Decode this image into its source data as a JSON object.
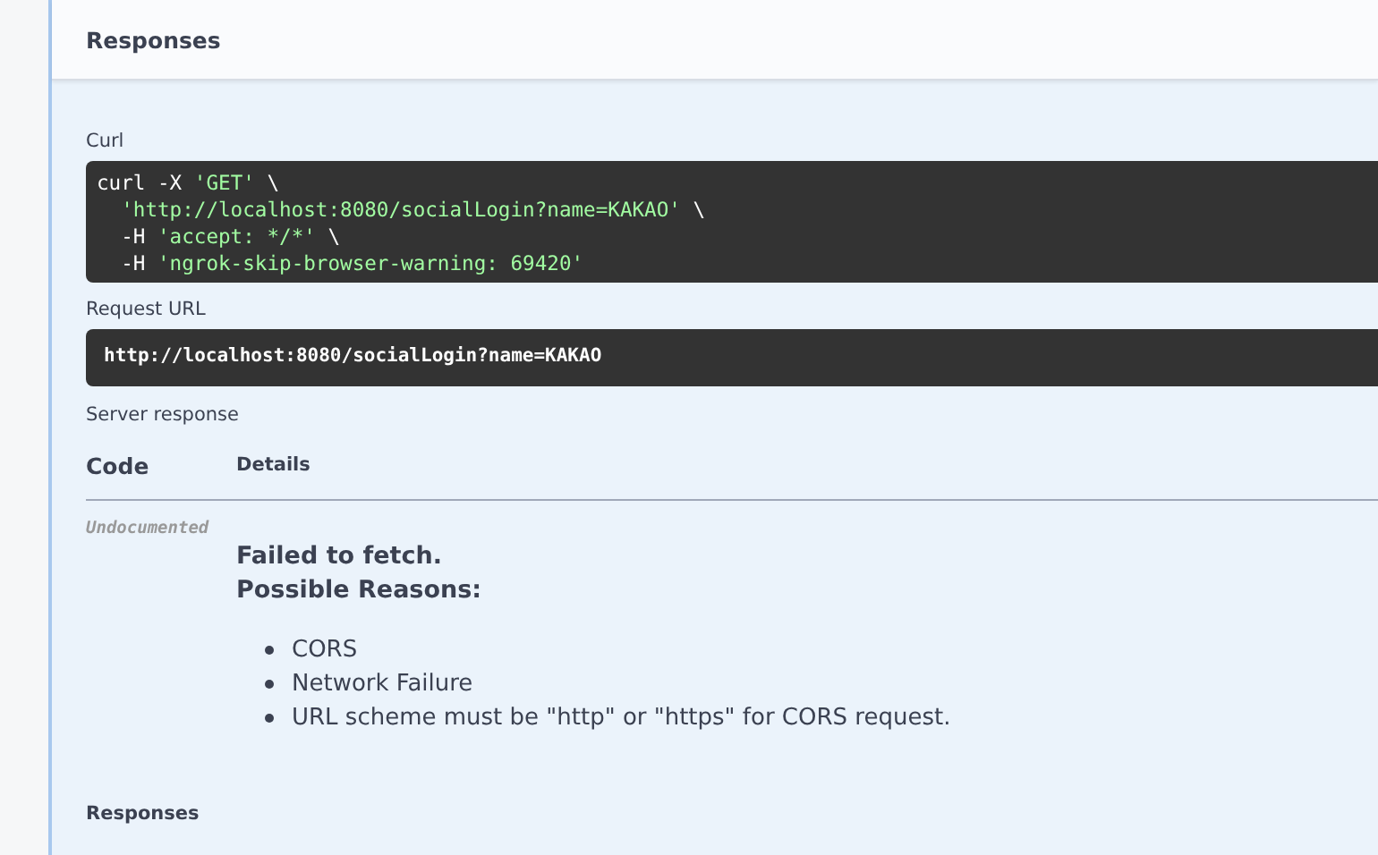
{
  "header": {
    "title": "Responses"
  },
  "curl": {
    "label": "Curl",
    "lines": [
      {
        "indented": false,
        "segments": [
          {
            "kind": "plain",
            "text": "curl -X "
          },
          {
            "kind": "string",
            "text": "'GET'"
          },
          {
            "kind": "plain",
            "text": " \\"
          }
        ]
      },
      {
        "indented": true,
        "segments": [
          {
            "kind": "string",
            "text": "'http://localhost:8080/socialLogin?name=KAKAO'"
          },
          {
            "kind": "plain",
            "text": " \\"
          }
        ]
      },
      {
        "indented": true,
        "segments": [
          {
            "kind": "plain",
            "text": "-H "
          },
          {
            "kind": "string",
            "text": "'accept: */*'"
          },
          {
            "kind": "plain",
            "text": " \\"
          }
        ]
      },
      {
        "indented": true,
        "segments": [
          {
            "kind": "plain",
            "text": "-H "
          },
          {
            "kind": "string",
            "text": "'ngrok-skip-browser-warning: 69420'"
          }
        ]
      }
    ]
  },
  "request_url": {
    "label": "Request URL",
    "value": "http://localhost:8080/socialLogin?name=KAKAO"
  },
  "server_response": {
    "label": "Server response",
    "columns": [
      "Code",
      "Details"
    ],
    "rows": [
      {
        "code": "Undocumented",
        "message": [
          "Failed to fetch.",
          "Possible Reasons:"
        ],
        "reasons": [
          "CORS",
          "Network Failure",
          "URL scheme must be \"http\" or \"https\" for CORS request."
        ]
      }
    ]
  },
  "footer_label": "Responses"
}
